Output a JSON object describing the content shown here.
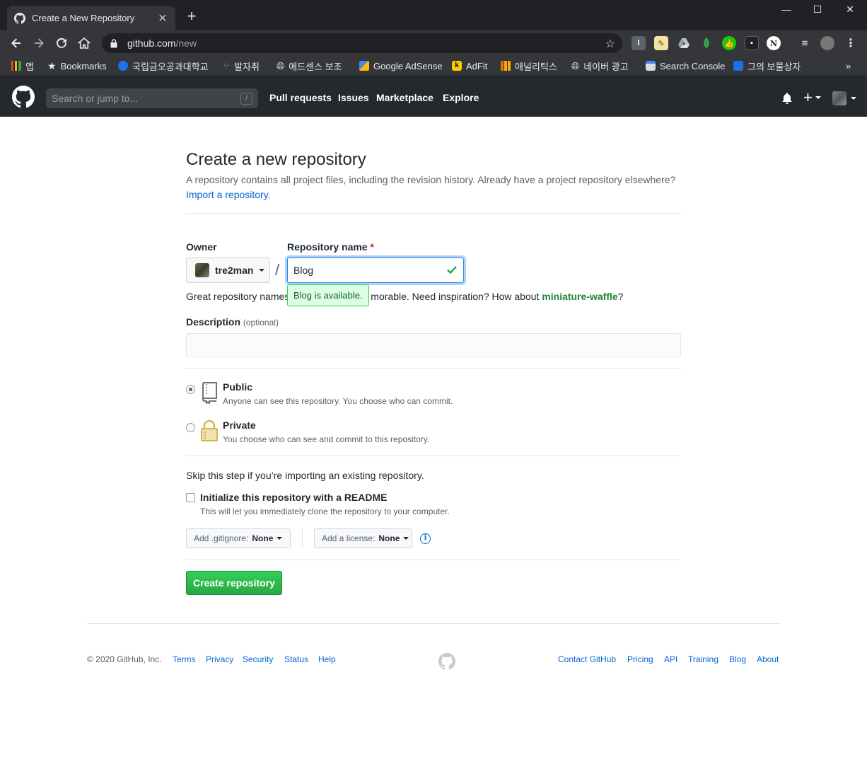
{
  "browser": {
    "tab_title": "Create a New Repository",
    "url_host": "github.com",
    "url_path": "/new",
    "bookmarks": [
      {
        "label": "앱",
        "color": "#e8453c"
      },
      {
        "label": "Bookmarks",
        "color": "#e8eaed"
      },
      {
        "label": "국립금오공과대학교",
        "color": "#1a73e8"
      },
      {
        "label": "발자취",
        "color": "#9aa0a6"
      },
      {
        "label": "애드센스 보조",
        "color": "#9aa0a6"
      },
      {
        "label": "Google AdSense",
        "color": "#fbbc04"
      },
      {
        "label": "AdFit",
        "color": "#ffcd00"
      },
      {
        "label": "애널리틱스",
        "color": "#f9ab00"
      },
      {
        "label": "네이버 광고",
        "color": "#9aa0a6"
      },
      {
        "label": "Search Console",
        "color": "#4285f4"
      },
      {
        "label": "그의 보물상자",
        "color": "#1a73e8"
      }
    ],
    "more_label": "»"
  },
  "header": {
    "search_placeholder": "Search or jump to...",
    "search_key": "/",
    "nav": [
      "Pull requests",
      "Issues",
      "Marketplace",
      "Explore"
    ]
  },
  "page": {
    "title": "Create a new repository",
    "subtitle": "A repository contains all project files, including the revision history. Already have a project repository elsewhere?",
    "import_link": "Import a repository.",
    "owner_label": "Owner",
    "owner_value": "tre2man",
    "repo_label": "Repository name",
    "required_mark": "*",
    "repo_value": "Blog",
    "separator": "/",
    "available_tooltip": "Blog is available.",
    "hint_prefix": "Great repository names",
    "hint_suffix": "morable. Need inspiration? How about",
    "hint_suggestion": "miniature-waffle",
    "hint_end": "?",
    "description_label": "Description",
    "description_optional": "(optional)",
    "description_value": "",
    "public_title": "Public",
    "public_note": "Anyone can see this repository. You choose who can commit.",
    "private_title": "Private",
    "private_note": "You choose who can see and commit to this repository.",
    "skip_note": "Skip this step if you’re importing an existing repository.",
    "readme_title": "Initialize this repository with a README",
    "readme_note": "This will let you immediately clone the repository to your computer.",
    "gitignore_label": "Add .gitignore:",
    "gitignore_value": "None",
    "license_label": "Add a license:",
    "license_value": "None",
    "info_glyph": "i",
    "create_button": "Create repository"
  },
  "footer": {
    "copyright": "© 2020 GitHub, Inc.",
    "left_links": [
      "Terms",
      "Privacy",
      "Security",
      "Status",
      "Help"
    ],
    "right_links": [
      "Contact GitHub",
      "Pricing",
      "API",
      "Training",
      "Blog",
      "About"
    ]
  },
  "colors": {
    "header_bg": "#24292e",
    "link": "#0366d6",
    "create_green": "#28a745",
    "available_bg": "#dcffe4"
  }
}
